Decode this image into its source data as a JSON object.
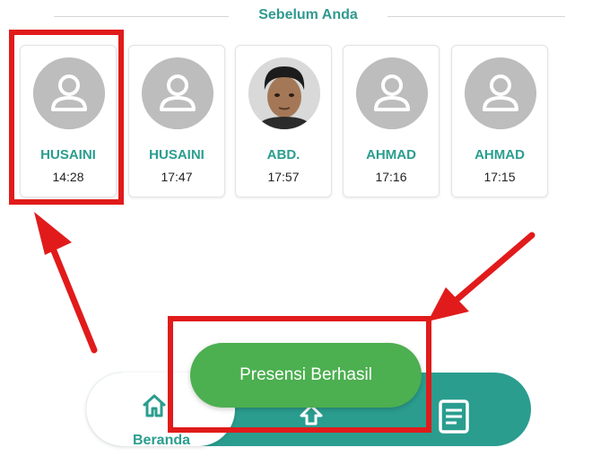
{
  "section": {
    "title": "Sebelum Anda"
  },
  "attendees": [
    {
      "name": "HUSAINI",
      "time": "14:28",
      "photo": "placeholder-avatar"
    },
    {
      "name": "HUSAINI",
      "time": "17:47",
      "photo": "placeholder-avatar"
    },
    {
      "name": "ABD.",
      "time": "17:57",
      "photo": "user-photo"
    },
    {
      "name": "AHMAD",
      "time": "17:16",
      "photo": "placeholder-avatar"
    },
    {
      "name": "AHMAD",
      "time": "17:15",
      "photo": "placeholder-avatar"
    }
  ],
  "toast": {
    "message": "Presensi Berhasil"
  },
  "bottom_nav": {
    "home_label": "Beranda",
    "items": [
      {
        "icon": "home-icon"
      },
      {
        "icon": "upload-icon"
      },
      {
        "icon": "document-list-icon"
      }
    ]
  },
  "colors": {
    "accent": "#2a9d8f",
    "toast": "#4caf50",
    "annotation": "#e11b1b",
    "avatar_gray": "#bdbdbd"
  }
}
